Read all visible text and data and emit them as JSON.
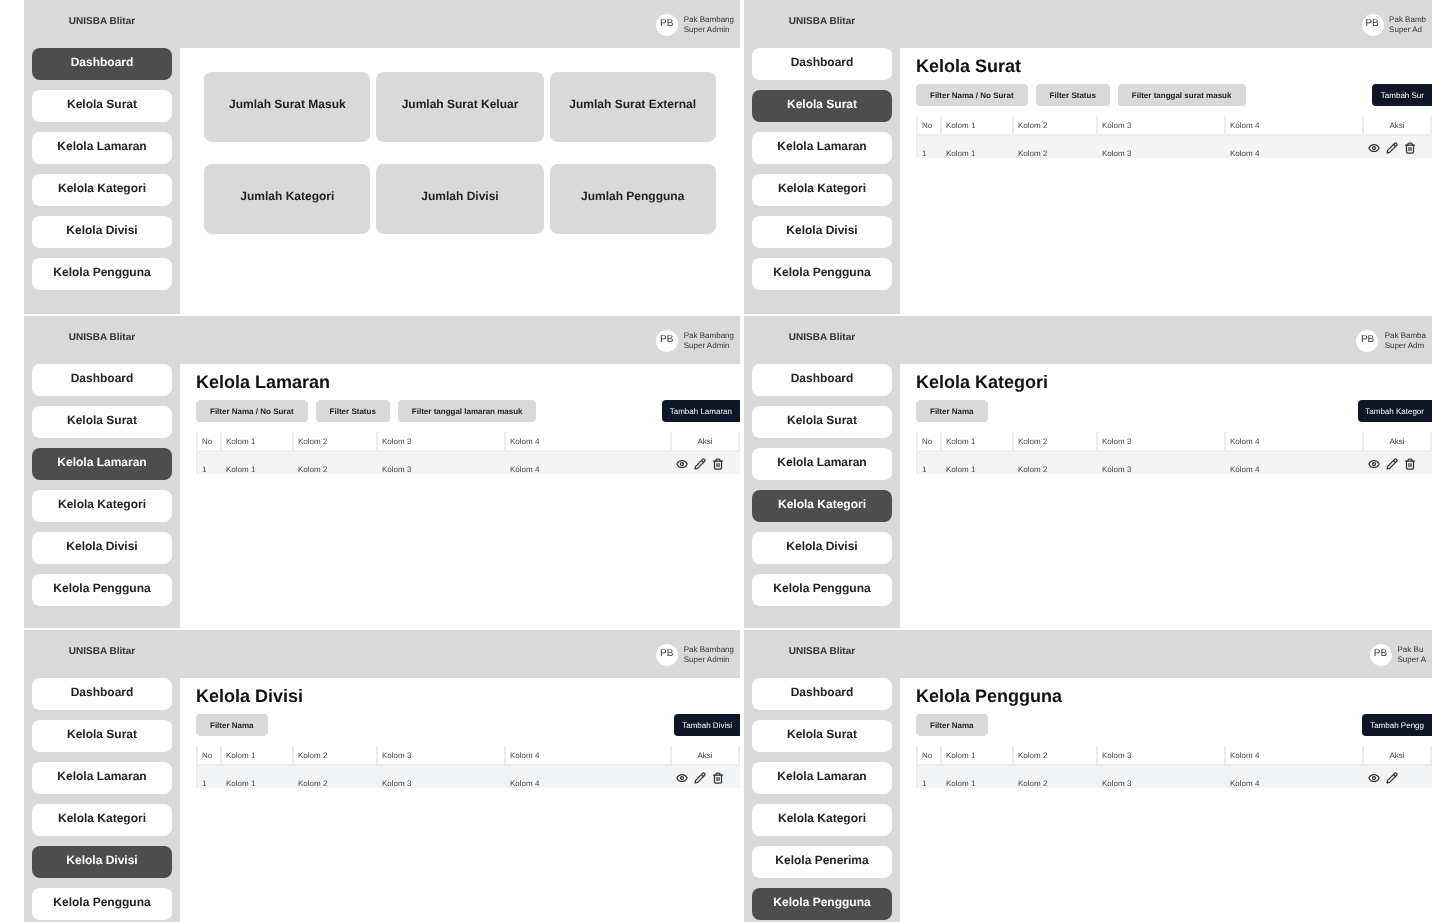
{
  "panels": [
    {
      "brand": "UNISBA Blitar",
      "user": {
        "initials": "PB",
        "name": "Pak Bambang",
        "role": "Super Admin"
      },
      "nav": [
        {
          "label": "Dashboard",
          "selected": true
        },
        {
          "label": "Kelola Surat",
          "selected": false
        },
        {
          "label": "Kelola Lamaran",
          "selected": false
        },
        {
          "label": "Kelola Kategori",
          "selected": false
        },
        {
          "label": "Kelola Divisi",
          "selected": false
        },
        {
          "label": "Kelola Pengguna",
          "selected": false
        }
      ],
      "content": {
        "kind": "dashboard",
        "cards": [
          "Jumlah Surat Masuk",
          "Jumlah Surat Keluar",
          "Jumlah Surat External",
          "Jumlah Kategori",
          "Jumlah Divisi",
          "Jumlah Pengguna"
        ]
      }
    },
    {
      "brand": "UNISBA Blitar",
      "user": {
        "initials": "PB",
        "name": "Pak Bamb",
        "role": "Super Ad"
      },
      "nav": [
        {
          "label": "Dashboard",
          "selected": false
        },
        {
          "label": "Kelola Surat",
          "selected": true
        },
        {
          "label": "Kelola Lamaran",
          "selected": false
        },
        {
          "label": "Kelola Kategori",
          "selected": false
        },
        {
          "label": "Kelola Divisi",
          "selected": false
        },
        {
          "label": "Kelola Pengguna",
          "selected": false
        }
      ],
      "content": {
        "kind": "table",
        "title": "Kelola Surat",
        "filters": [
          "Filter Nama / No Surat",
          "Filter Status",
          "Filter tanggal surat masuk"
        ],
        "add_button": "Tambah Sur",
        "columns": [
          "No",
          "Kolom 1",
          "Kolom 2",
          "Kolom 3",
          "Kolom 4",
          "Aksi"
        ],
        "rows": [
          [
            "1",
            "Kolom 1",
            "Kolom 2",
            "Kolom 3",
            "Kolom 4"
          ]
        ],
        "actions": [
          {
            "kind": "view"
          },
          {
            "kind": "edit"
          },
          {
            "kind": "delete"
          }
        ]
      }
    },
    {
      "brand": "UNISBA Blitar",
      "user": {
        "initials": "PB",
        "name": "Pak Bambang",
        "role": "Super Admin"
      },
      "nav": [
        {
          "label": "Dashboard",
          "selected": false
        },
        {
          "label": "Kelola Surat",
          "selected": false
        },
        {
          "label": "Kelola Lamaran",
          "selected": true
        },
        {
          "label": "Kelola Kategori",
          "selected": false
        },
        {
          "label": "Kelola Divisi",
          "selected": false
        },
        {
          "label": "Kelola Pengguna",
          "selected": false
        }
      ],
      "content": {
        "kind": "table",
        "title": "Kelola Lamaran",
        "filters": [
          "Filter Nama / No Surat",
          "Filter Status",
          "Filter tanggal lamaran masuk"
        ],
        "add_button": "Tambah Lamaran",
        "columns": [
          "No",
          "Kolom 1",
          "Kolom 2",
          "Kolom 3",
          "Kolom 4",
          "Aksi"
        ],
        "rows": [
          [
            "1",
            "Kolom 1",
            "Kolom 2",
            "Kolom 3",
            "Kolom 4"
          ]
        ],
        "actions": [
          {
            "kind": "view"
          },
          {
            "kind": "edit"
          },
          {
            "kind": "delete"
          }
        ]
      }
    },
    {
      "brand": "UNISBA Blitar",
      "user": {
        "initials": "PB",
        "name": "Pak Bamba",
        "role": "Super Adm"
      },
      "nav": [
        {
          "label": "Dashboard",
          "selected": false
        },
        {
          "label": "Kelola Surat",
          "selected": false
        },
        {
          "label": "Kelola Lamaran",
          "selected": false
        },
        {
          "label": "Kelola Kategori",
          "selected": true
        },
        {
          "label": "Kelola Divisi",
          "selected": false
        },
        {
          "label": "Kelola Pengguna",
          "selected": false
        }
      ],
      "content": {
        "kind": "table",
        "title": "Kelola Kategori",
        "filters": [
          "Filter Nama"
        ],
        "add_button": "Tambah Kategor",
        "columns": [
          "No",
          "Kolom 1",
          "Kolom 2",
          "Kolom 3",
          "Kolom 4",
          "Aksi"
        ],
        "rows": [
          [
            "1",
            "Kolom 1",
            "Kolom 2",
            "Kolom 3",
            "Kolom 4"
          ]
        ],
        "actions": [
          {
            "kind": "view"
          },
          {
            "kind": "edit"
          },
          {
            "kind": "delete"
          }
        ]
      }
    },
    {
      "brand": "UNISBA Blitar",
      "user": {
        "initials": "PB",
        "name": "Pak Bambang",
        "role": "Super Admin"
      },
      "nav": [
        {
          "label": "Dashboard",
          "selected": false
        },
        {
          "label": "Kelola Surat",
          "selected": false
        },
        {
          "label": "Kelola Lamaran",
          "selected": false
        },
        {
          "label": "Kelola Kategori",
          "selected": false
        },
        {
          "label": "Kelola Divisi",
          "selected": true
        },
        {
          "label": "Kelola Pengguna",
          "selected": false
        }
      ],
      "content": {
        "kind": "table",
        "title": "Kelola Divisi",
        "filters": [
          "Filter Nama"
        ],
        "add_button": "Tambah Divisi",
        "columns": [
          "No",
          "Kolom 1",
          "Kolom 2",
          "Kolom 3",
          "Kolom 4",
          "Aksi"
        ],
        "rows": [
          [
            "1",
            "Kolom 1",
            "Kolom 2",
            "Kolom 3",
            "Kolom 4"
          ]
        ],
        "actions": [
          {
            "kind": "view"
          },
          {
            "kind": "edit"
          },
          {
            "kind": "delete"
          }
        ]
      }
    },
    {
      "brand": "UNISBA Blitar",
      "user": {
        "initials": "PB",
        "name": "Pak Bu",
        "role": "Super A"
      },
      "nav": [
        {
          "label": "Dashboard",
          "selected": false
        },
        {
          "label": "Kelola Surat",
          "selected": false
        },
        {
          "label": "Kelola Lamaran",
          "selected": false
        },
        {
          "label": "Kelola Kategori",
          "selected": false
        },
        {
          "label": "Kelola Penerima",
          "selected": false
        },
        {
          "label": "Kelola Pengguna",
          "selected": true
        }
      ],
      "content": {
        "kind": "table",
        "title": "Kelola Pengguna",
        "filters": [
          "Filter Nama"
        ],
        "add_button": "Tambah Pengg",
        "columns": [
          "No",
          "Kolom 1",
          "Kolom 2",
          "Kolom 3",
          "Kolom 4",
          "Aksi"
        ],
        "rows": [
          [
            "1",
            "Kolom 1",
            "Kolom 2",
            "Kolom 3",
            "Kolom 4"
          ]
        ],
        "actions": [
          {
            "kind": "view"
          },
          {
            "kind": "edit"
          }
        ]
      }
    }
  ]
}
